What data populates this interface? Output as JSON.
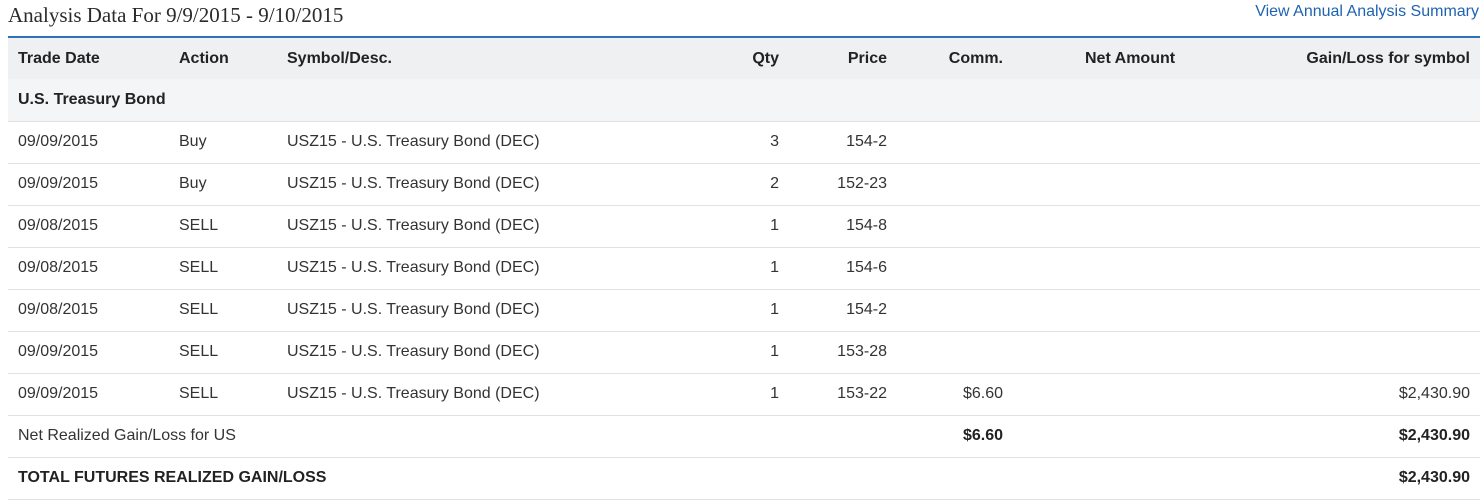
{
  "header": {
    "title": "Analysis Data For 9/9/2015 - 9/10/2015",
    "summary_link": "View Annual Analysis Summary"
  },
  "table": {
    "columns": {
      "trade_date": "Trade Date",
      "action": "Action",
      "symbol": "Symbol/Desc.",
      "qty": "Qty",
      "price": "Price",
      "comm": "Comm.",
      "net_amount": "Net Amount",
      "gain_loss": "Gain/Loss for symbol"
    },
    "group_label": "U.S. Treasury Bond",
    "rows": [
      {
        "date": "09/09/2015",
        "action": "Buy",
        "symbol": "USZ15 - U.S. Treasury Bond (DEC)",
        "qty": "3",
        "price": "154-2",
        "comm": "",
        "net": "",
        "gain": ""
      },
      {
        "date": "09/09/2015",
        "action": "Buy",
        "symbol": "USZ15 - U.S. Treasury Bond (DEC)",
        "qty": "2",
        "price": "152-23",
        "comm": "",
        "net": "",
        "gain": ""
      },
      {
        "date": "09/08/2015",
        "action": "SELL",
        "symbol": "USZ15 - U.S. Treasury Bond (DEC)",
        "qty": "1",
        "price": "154-8",
        "comm": "",
        "net": "",
        "gain": ""
      },
      {
        "date": "09/08/2015",
        "action": "SELL",
        "symbol": "USZ15 - U.S. Treasury Bond (DEC)",
        "qty": "1",
        "price": "154-6",
        "comm": "",
        "net": "",
        "gain": ""
      },
      {
        "date": "09/08/2015",
        "action": "SELL",
        "symbol": "USZ15 - U.S. Treasury Bond (DEC)",
        "qty": "1",
        "price": "154-2",
        "comm": "",
        "net": "",
        "gain": ""
      },
      {
        "date": "09/09/2015",
        "action": "SELL",
        "symbol": "USZ15 - U.S. Treasury Bond (DEC)",
        "qty": "1",
        "price": "153-28",
        "comm": "",
        "net": "",
        "gain": ""
      },
      {
        "date": "09/09/2015",
        "action": "SELL",
        "symbol": "USZ15 - U.S. Treasury Bond (DEC)",
        "qty": "1",
        "price": "153-22",
        "comm": "$6.60",
        "net": "",
        "gain": "$2,430.90"
      }
    ],
    "subtotal": {
      "label": "Net Realized Gain/Loss for US",
      "comm": "$6.60",
      "gain": "$2,430.90"
    },
    "grand_total": {
      "label": "TOTAL FUTURES REALIZED GAIN/LOSS",
      "gain": "$2,430.90"
    }
  },
  "colors": {
    "accent": "#2f72b8",
    "link": "#1f63b0",
    "header_bg": "#eef0f2"
  }
}
